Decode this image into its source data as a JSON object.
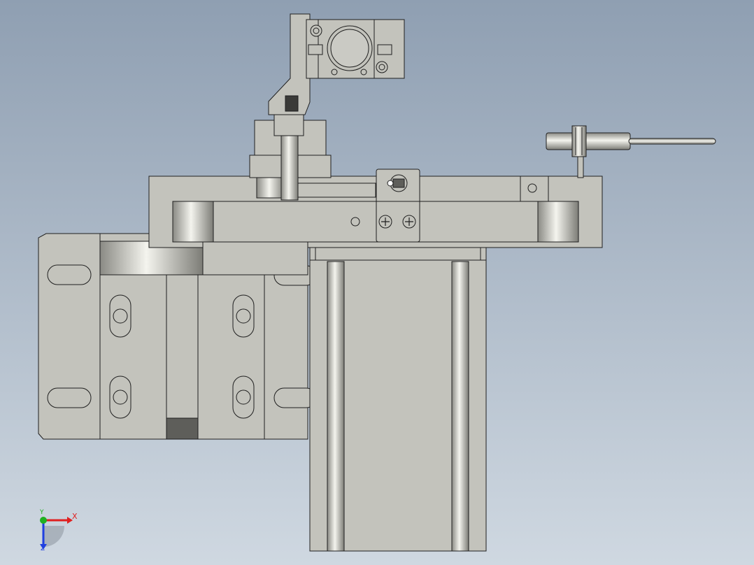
{
  "viewport": {
    "background_top": "#8f9fb2",
    "background_bottom": "#cfd8e1",
    "part_fill": "#c3c3bc",
    "part_stroke": "#1f1f1f",
    "shadow_fill": "#5e5e5a"
  },
  "triad": {
    "x_label": "X",
    "y_label": "Y",
    "z_label": "Z",
    "x_color": "#e02020",
    "y_color": "#20b020",
    "z_color": "#2040e0"
  }
}
